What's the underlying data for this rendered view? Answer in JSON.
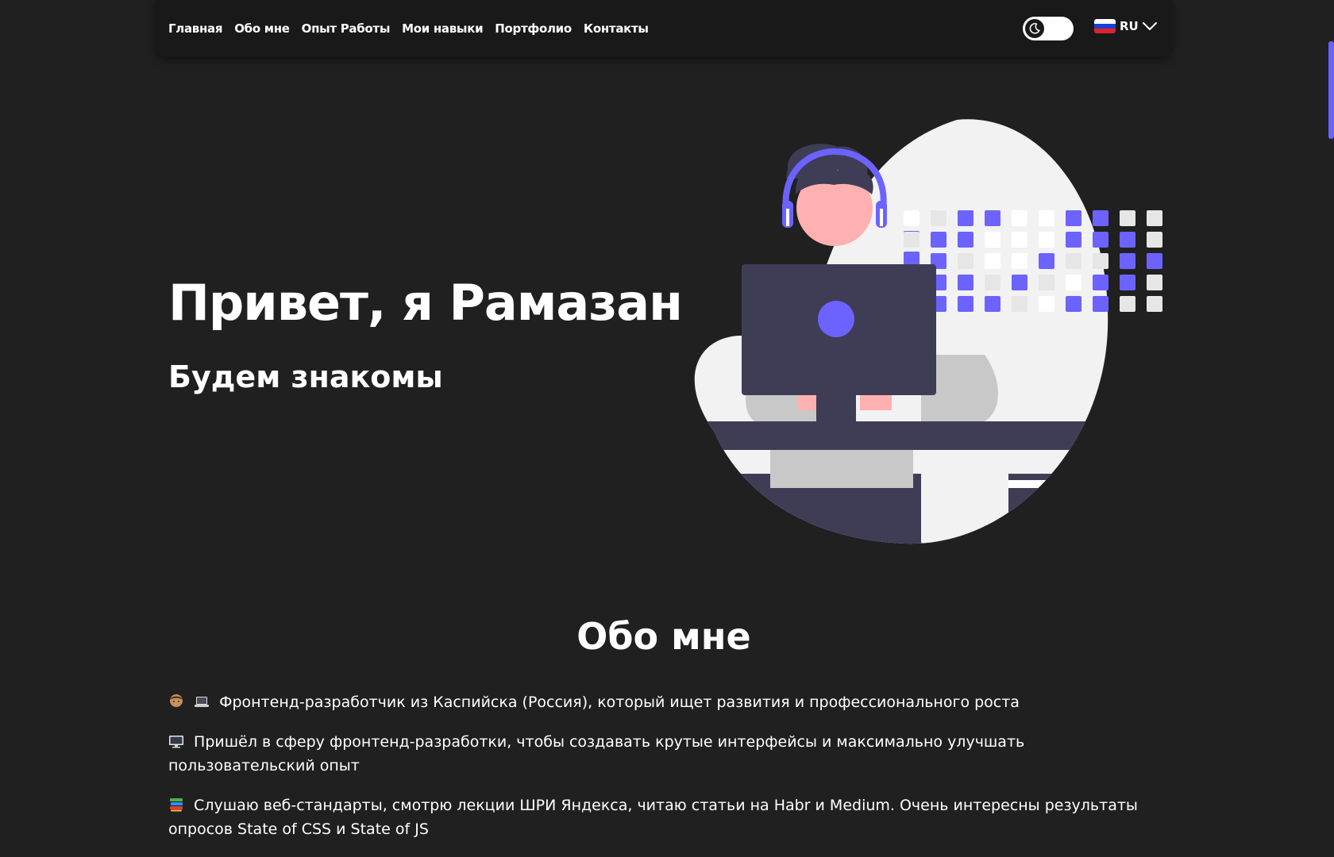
{
  "nav": {
    "links": [
      "Главная",
      "Обо мне",
      "Опыт Работы",
      "Мои навыки",
      "Портфолио",
      "Контакты"
    ],
    "theme_toggle_icon": "moon-icon",
    "language": "RU",
    "language_flag_icon": "russia-flag-icon",
    "dropdown_icon": "chevron-down-icon"
  },
  "hero": {
    "title": "Привет, я Рамазан",
    "subtitle": "Будем знакомы",
    "illustration_icon": "developer-at-computer-illustration"
  },
  "about": {
    "title": "Обо мне",
    "items": [
      {
        "icons": [
          "man-technologist-icon",
          "laptop-icon"
        ],
        "text": "Фронтенд-разработчик из Каспийска (Россия), который ищет развития и профессионального роста"
      },
      {
        "icons": [
          "desktop-computer-icon"
        ],
        "text": "Пришёл в сферу фронтенд-разработки, чтобы создавать крутые интерфейсы и максимально улучшать пользовательский опыт"
      },
      {
        "icons": [
          "books-icon"
        ],
        "text": "Слушаю веб-стандарты, смотрю лекции ШРИ Яндекса, читаю статьи на Habr и Medium. Очень интересны результаты опросов State of CSS и State of JS"
      }
    ]
  },
  "colors": {
    "background": "#212020",
    "navbar": "#1a1919",
    "accent": "#6c63ff",
    "text": "#ffffff"
  }
}
